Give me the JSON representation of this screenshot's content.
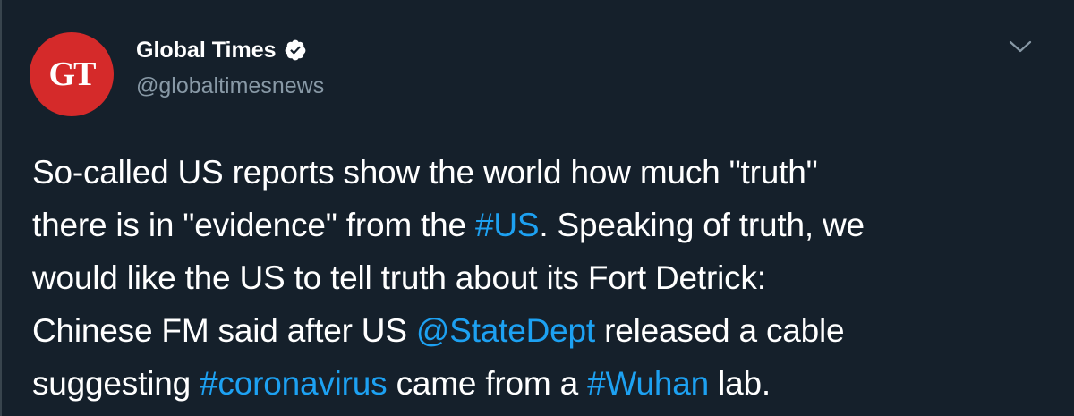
{
  "author": {
    "avatar_text": "GT",
    "display_name": "Global Times",
    "handle": "@globaltimesnews",
    "verified": true
  },
  "tweet": {
    "line1": {
      "t1": "So-called US reports show the world how much \"truth\""
    },
    "line2": {
      "t1": "there is in \"evidence\" from the ",
      "link1": "#US",
      "t2": ". Speaking of truth, we"
    },
    "line3": {
      "t1": "would like the US to tell truth about its Fort Detrick:"
    },
    "line4": {
      "t1": "Chinese FM said after US ",
      "link1": "@StateDept",
      "t2": " released a cable"
    },
    "line5": {
      "t1": "suggesting ",
      "link1": "#coronavirus",
      "t2": " came from a ",
      "link2": "#Wuhan",
      "t3": " lab."
    }
  },
  "icons": {
    "verified": "verified-badge-icon",
    "more": "chevron-down-icon"
  },
  "colors": {
    "background": "#15202b",
    "text": "#ffffff",
    "secondary_text": "#8899a6",
    "link": "#1da1f2",
    "avatar_bg": "#d52a2a"
  }
}
